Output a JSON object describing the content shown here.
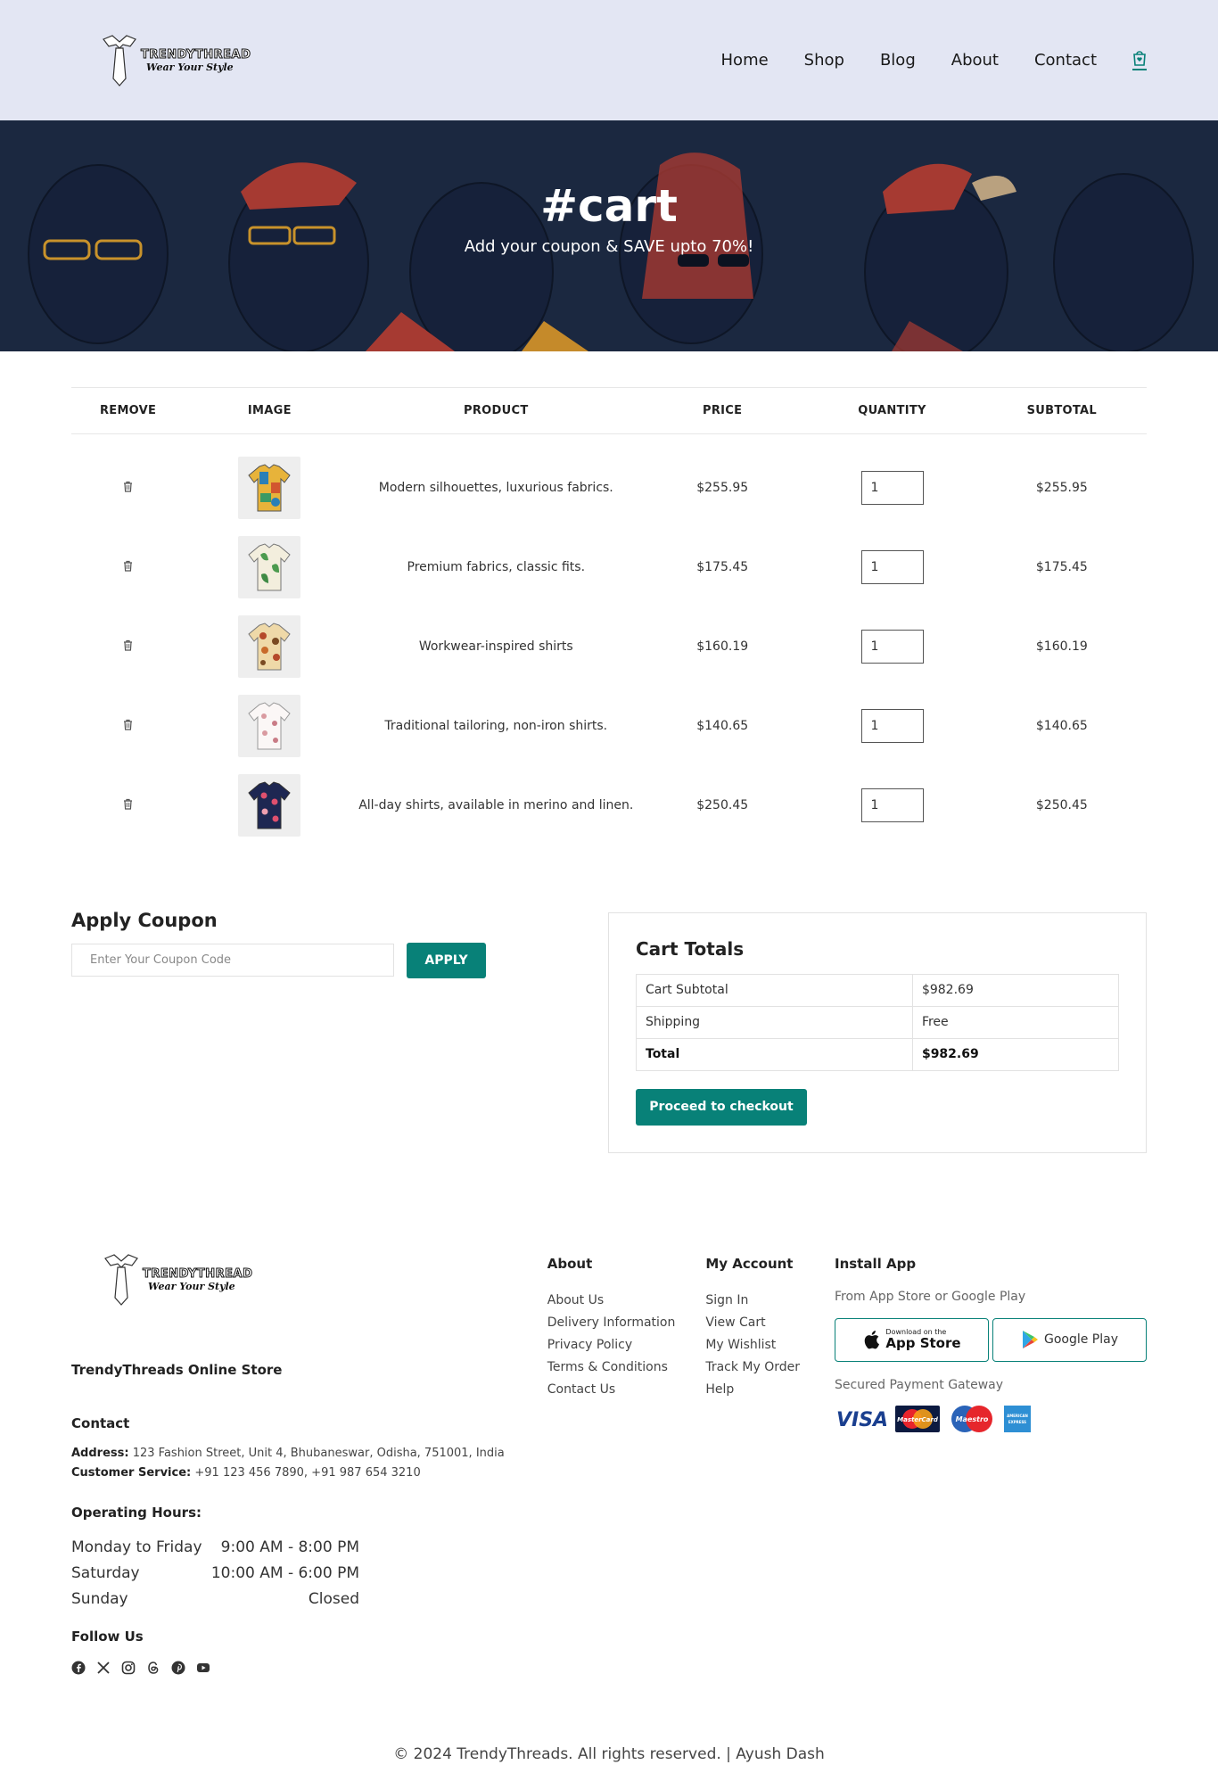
{
  "header": {
    "logo_name": "TRENDYTHREAD",
    "logo_tagline": "Wear Your Style",
    "nav": [
      "Home",
      "Shop",
      "Blog",
      "About",
      "Contact"
    ],
    "cart_icon": "shopping-bag-icon"
  },
  "hero": {
    "title": "#cart",
    "subtitle": "Add your coupon & SAVE upto 70%!"
  },
  "cart": {
    "headers": [
      "REMOVE",
      "IMAGE",
      "PRODUCT",
      "PRICE",
      "QUANTITY",
      "SUBTOTAL"
    ],
    "items": [
      {
        "product": "Modern silhouettes, luxurious fabrics.",
        "price": "$255.95",
        "qty": "1",
        "subtotal": "$255.95"
      },
      {
        "product": "Premium fabrics, classic fits.",
        "price": "$175.45",
        "qty": "1",
        "subtotal": "$175.45"
      },
      {
        "product": "Workwear-inspired shirts",
        "price": "$160.19",
        "qty": "1",
        "subtotal": "$160.19"
      },
      {
        "product": "Traditional tailoring, non-iron shirts.",
        "price": "$140.65",
        "qty": "1",
        "subtotal": "$140.65"
      },
      {
        "product": "All-day shirts, available in merino and linen.",
        "price": "$250.45",
        "qty": "1",
        "subtotal": "$250.45"
      }
    ]
  },
  "coupon": {
    "title": "Apply Coupon",
    "placeholder": "Enter Your Coupon Code",
    "button": "APPLY"
  },
  "totals": {
    "title": "Cart Totals",
    "rows": [
      {
        "label": "Cart Subtotal",
        "value": "$982.69"
      },
      {
        "label": "Shipping",
        "value": "Free"
      },
      {
        "label": "Total",
        "value": "$982.69"
      }
    ],
    "checkout": "Proceed to checkout"
  },
  "footer": {
    "store_name": "TrendyThreads Online Store",
    "contact_title": "Contact",
    "address_label": "Address:",
    "address": "123 Fashion Street, Unit 4, Bhubaneswar, Odisha, 751001, India",
    "service_label": "Customer Service:",
    "service": "+91 123 456 7890, +91 987 654 3210",
    "hours_title": "Operating Hours:",
    "hours": [
      {
        "day": "Monday to Friday",
        "time": "9:00 AM - 8:00 PM"
      },
      {
        "day": "Saturday",
        "time": "10:00 AM - 6:00 PM"
      },
      {
        "day": "Sunday",
        "time": "Closed"
      }
    ],
    "follow_title": "Follow Us",
    "social_icons": [
      "facebook-icon",
      "x-icon",
      "instagram-icon",
      "threads-icon",
      "pinterest-icon",
      "youtube-icon"
    ],
    "about_title": "About",
    "about_links": [
      "About Us",
      "Delivery Information",
      "Privacy Policy",
      "Terms & Conditions",
      "Contact Us"
    ],
    "account_title": "My Account",
    "account_links": [
      "Sign In",
      "View Cart",
      "My Wishlist",
      "Track My Order",
      "Help"
    ],
    "app_title": "Install App",
    "app_sub": "From App Store or Google Play",
    "appstore_small": "Download on the",
    "appstore_big": "App Store",
    "googleplay": "Google Play",
    "payment_label": "Secured Payment Gateway",
    "cards": [
      "VISA",
      "MasterCard",
      "Maestro",
      "AMERICAN EXPRESS"
    ],
    "copyright": "© 2024 TrendyThreads. All rights reserved. | Ayush Dash"
  },
  "colors": {
    "accent": "#088178",
    "header_bg": "#e3e6f3",
    "hero_bg": "#1b2840"
  }
}
